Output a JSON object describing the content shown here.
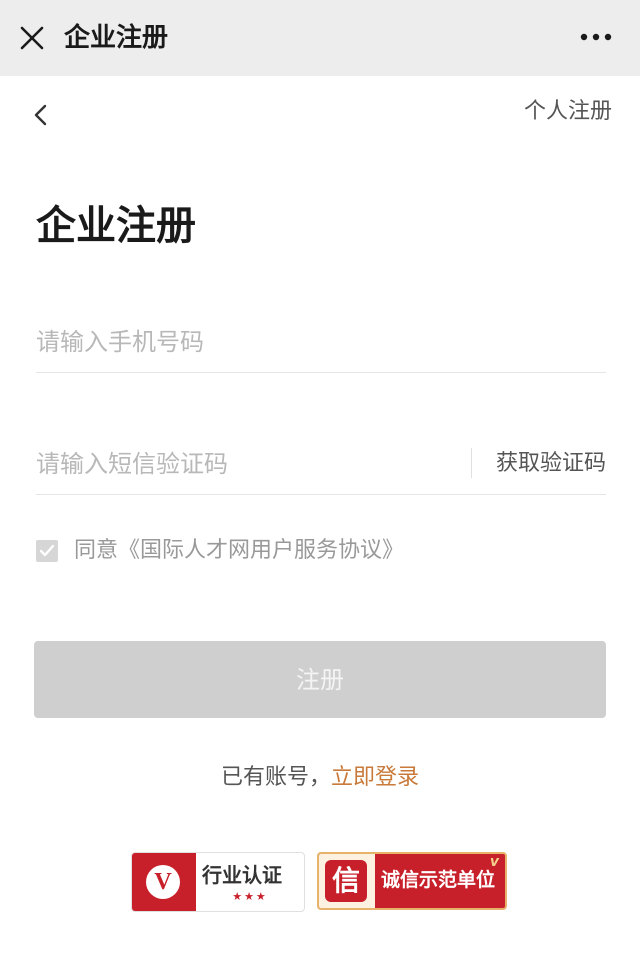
{
  "titlebar": {
    "title": "企业注册",
    "close_icon": "close-icon",
    "more_icon": "more-icon"
  },
  "nav": {
    "back_icon": "chevron-left-icon",
    "personal_register_label": "个人注册"
  },
  "page": {
    "title": "企业注册"
  },
  "form": {
    "phone": {
      "placeholder": "请输入手机号码",
      "value": ""
    },
    "code": {
      "placeholder": "请输入短信验证码",
      "value": ""
    },
    "get_code_label": "获取验证码",
    "agreement": {
      "checked": true,
      "text": "同意《国际人才网用户服务协议》"
    },
    "submit_label": "注册"
  },
  "login": {
    "prompt": "已有账号，",
    "link_label": "立即登录"
  },
  "badges": {
    "industry": {
      "label": "行业认证",
      "stars": "★★★"
    },
    "credit": {
      "label": "诚信示范单位"
    }
  },
  "colors": {
    "titlebar_bg": "#ededed",
    "button_disabled": "#cfcfcf",
    "link_accent": "#c97a3a",
    "badge_red": "#c8202a"
  }
}
